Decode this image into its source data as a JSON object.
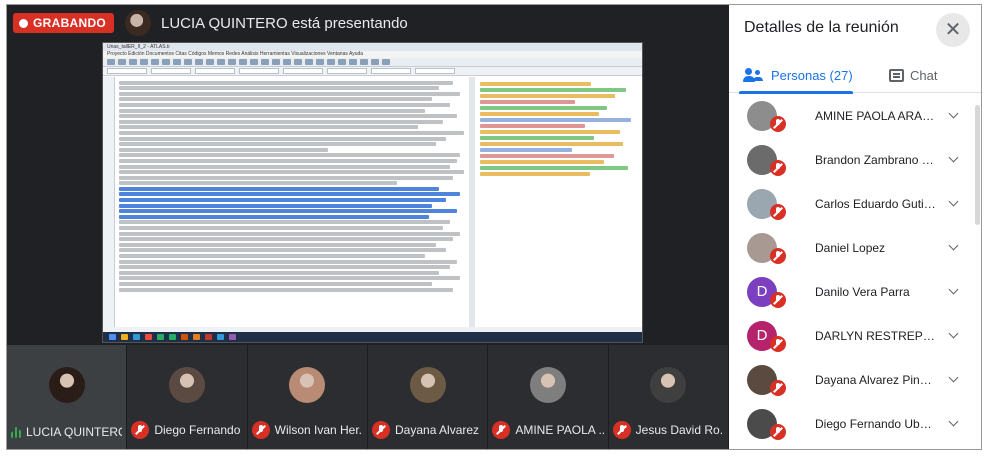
{
  "recording": {
    "label": "GRABANDO"
  },
  "presenter": {
    "text": "LUCIA QUINTERO está presentando"
  },
  "panel": {
    "title": "Detalles de la reunión",
    "close": "✕",
    "tabs": {
      "people": "Personas (27)",
      "chat": "Chat"
    },
    "participants": [
      {
        "name": "AMINE PAOLA ARAME...",
        "initial": "",
        "color": "#8d8d8d"
      },
      {
        "name": "Brandon Zambrano Gó...",
        "initial": "",
        "color": "#6b6b6b"
      },
      {
        "name": "Carlos Eduardo Gutierre...",
        "initial": "",
        "color": "#9aa6b0"
      },
      {
        "name": "Daniel Lopez",
        "initial": "",
        "color": "#a89a92"
      },
      {
        "name": "Danilo Vera Parra",
        "initial": "D",
        "color": "#7b3fbf"
      },
      {
        "name": "DARLYN RESTREPO AR...",
        "initial": "D",
        "color": "#b4236b"
      },
      {
        "name": "Dayana Alvarez Pineros",
        "initial": "",
        "color": "#5a4a3f"
      },
      {
        "name": "Diego Fernando Ubaque...",
        "initial": "",
        "color": "#4b4b4b"
      }
    ]
  },
  "strip": [
    {
      "name": "LUCIA QUINTERO",
      "speaking": true
    },
    {
      "name": "Diego Fernando ...",
      "speaking": false
    },
    {
      "name": "Wilson Ivan Her...",
      "speaking": false
    },
    {
      "name": "Dayana Alvarez ...",
      "speaking": false
    },
    {
      "name": "AMINE PAOLA ...",
      "speaking": false
    },
    {
      "name": "Jesus David Ro...",
      "speaking": false
    }
  ],
  "screen": {
    "window_title": "Unas_tallER_II_2 - ATLAS.ti",
    "menu": "Proyecto  Edición  Documentos  Citas  Códigos  Memos  Redes  Análisis  Herramientas  Visualizaciones  Ventanas  Ayuda"
  }
}
